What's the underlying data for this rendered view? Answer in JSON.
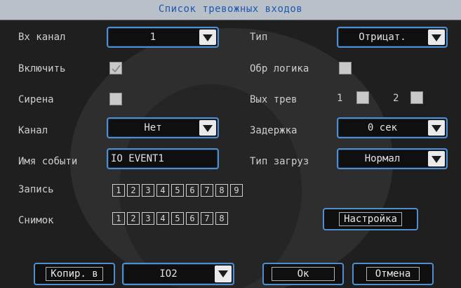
{
  "title": "Список тревожных входов",
  "left": {
    "channel_label": "Вх канал",
    "channel_value": "1",
    "enable_label": "Включить",
    "siren_label": "Сирена",
    "kanal_label": "Канал",
    "kanal_value": "Нет",
    "event_name_label": "Имя событи",
    "event_name_value": "IO EVENT1",
    "record_label": "Запись",
    "record_channels": [
      "1",
      "2",
      "3",
      "4",
      "5",
      "6",
      "7",
      "8",
      "9"
    ],
    "snapshot_label": "Снимок",
    "snapshot_channels": [
      "1",
      "2",
      "3",
      "4",
      "5",
      "6",
      "7",
      "8"
    ]
  },
  "right": {
    "type_label": "Тип",
    "type_value": "Отрицат.",
    "reverse_logic_label": "Обр логика",
    "alarm_out_label": "Вых трев",
    "alarm_out_1": "1",
    "alarm_out_2": "2",
    "delay_label": "Задержка",
    "delay_value": "0 сек",
    "load_type_label": "Тип загруз",
    "load_type_value": "Нормал",
    "settings_button": "Настройка"
  },
  "footer": {
    "copy_button": "Копир. в",
    "copy_target_value": "IO2",
    "ok_button": "Ок",
    "cancel_button": "Отмена"
  },
  "state": {
    "enable_checked": true,
    "siren_checked": false,
    "reverse_logic_checked": false
  },
  "icons": {
    "dropdown": "chevron-down-icon",
    "checkbox": "checkbox"
  },
  "colors": {
    "title_text": "#1b59b3",
    "title_bar": "#b9c0c8",
    "control_border": "#4f8fd0",
    "label_text": "#cfcfcf"
  }
}
